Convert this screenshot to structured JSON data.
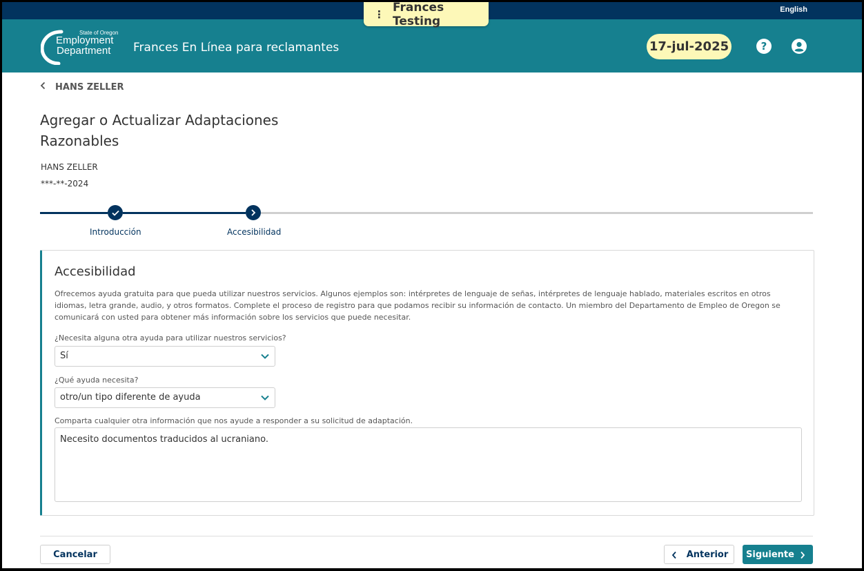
{
  "header": {
    "language_link": "English",
    "logo": {
      "line1": "State of Oregon",
      "line2": "Employment",
      "line3": "Department"
    },
    "app_title": "Frances En Línea para reclamantes",
    "date": "17-jul-2025",
    "help_icon_glyph": "?",
    "test_banner": {
      "dots": "⋮",
      "label": "Frances Testing"
    }
  },
  "nav": {
    "back_label": "HANS ZELLER"
  },
  "page": {
    "title": "Agregar o Actualizar Adaptaciones Razonables",
    "claimant_name": "HANS ZELLER",
    "claimant_ssn": "***-**-2024"
  },
  "stepper": {
    "steps": [
      {
        "label": "Introducción",
        "state": "complete"
      },
      {
        "label": "Accesibilidad",
        "state": "current"
      }
    ]
  },
  "card": {
    "title": "Accesibilidad",
    "description": "Ofrecemos ayuda gratuita para que pueda utilizar nuestros servicios. Algunos ejemplos son: intérpretes de lenguaje de señas, intérpretes de lenguaje hablado, materiales escritos en otros idiomas, letra grande, audio, y otros formatos. Complete el proceso de registro para que podamos recibir su información de contacto. Un miembro del Departamento de Empleo de Oregon se comunicará con usted para obtener más información sobre los servicios que puede necesitar.",
    "q1_label": "¿Necesita alguna otra ayuda para utilizar nuestros servicios?",
    "q1_value": "Sí",
    "q2_label": "¿Qué ayuda necesita?",
    "q2_value": "otro/un tipo diferente de ayuda",
    "q3_label": "Comparta cualquier otra información que nos ayude a responder a su solicitud de adaptación.",
    "q3_value": "Necesito documentos traducidos al ucraniano."
  },
  "footer": {
    "cancel_label": "Cancelar",
    "previous_label": "Anterior",
    "next_label": "Siguiente"
  },
  "colors": {
    "navy": "#02335e",
    "teal": "#16808f",
    "date_pill": "#fdf8b8"
  }
}
